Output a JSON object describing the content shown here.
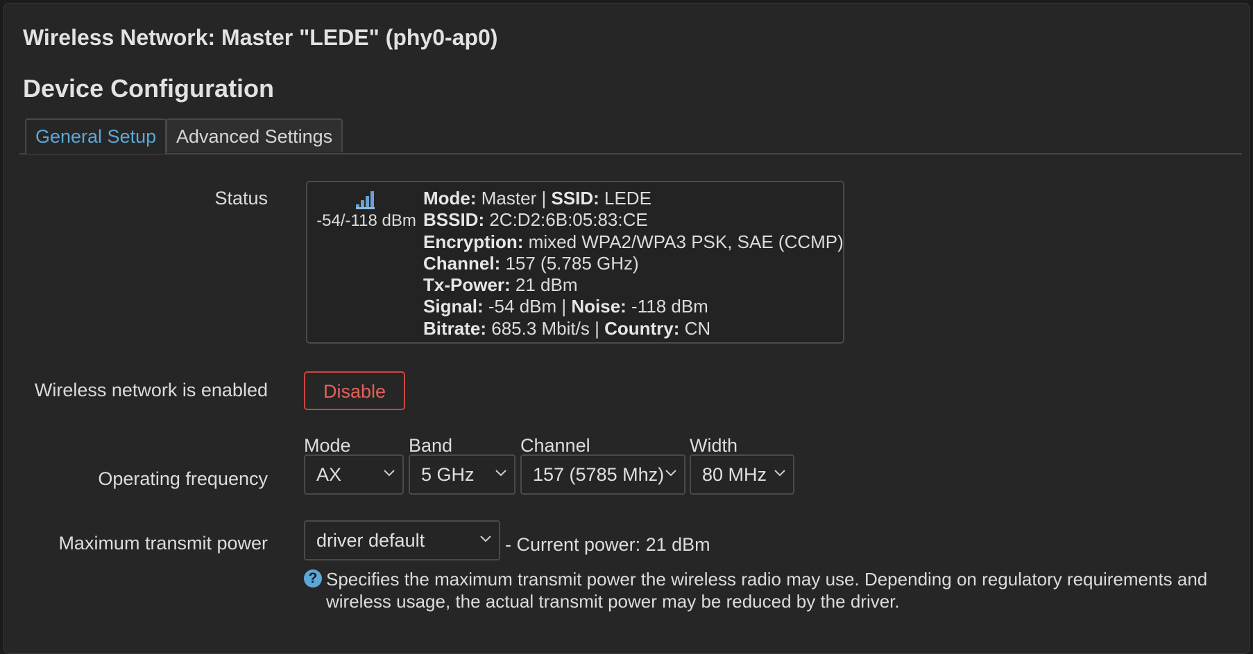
{
  "modal": {
    "title": "Wireless Network: Master \"LEDE\" (phy0-ap0)",
    "section_title": "Device Configuration"
  },
  "tabs": [
    {
      "label": "General Setup",
      "active": true
    },
    {
      "label": "Advanced Settings",
      "active": false
    }
  ],
  "status": {
    "label": "Status",
    "signal_text": "-54/-118 dBm",
    "signal_icon": "signal-bars-icon",
    "lines": [
      {
        "k1": "Mode:",
        "v1": " Master | ",
        "k2": "SSID:",
        "v2": " LEDE"
      },
      {
        "k1": "BSSID:",
        "v1": " 2C:D2:6B:05:83:CE",
        "k2": "",
        "v2": ""
      },
      {
        "k1": "Encryption:",
        "v1": " mixed WPA2/WPA3 PSK, SAE (CCMP)",
        "k2": "",
        "v2": ""
      },
      {
        "k1": "Channel:",
        "v1": " 157 (5.785 GHz)",
        "k2": "",
        "v2": ""
      },
      {
        "k1": "Tx-Power:",
        "v1": " 21 dBm",
        "k2": "",
        "v2": ""
      },
      {
        "k1": "Signal:",
        "v1": " -54 dBm | ",
        "k2": "Noise:",
        "v2": " -118 dBm"
      },
      {
        "k1": "Bitrate:",
        "v1": " 685.3 Mbit/s | ",
        "k2": "Country:",
        "v2": " CN"
      }
    ]
  },
  "enabled": {
    "label": "Wireless network is enabled",
    "button_label": "Disable"
  },
  "frequency": {
    "label": "Operating frequency",
    "mode_label": "Mode",
    "mode_value": "AX",
    "band_label": "Band",
    "band_value": "5 GHz",
    "channel_label": "Channel",
    "channel_value": "157 (5785 Mhz)",
    "width_label": "Width",
    "width_value": "80 MHz"
  },
  "txpower": {
    "label": "Maximum transmit power",
    "value": "driver default",
    "current": "- Current power: 21 dBm",
    "help": "Specifies the maximum transmit power the wireless radio may use. Depending on regulatory requirements and wireless usage, the actual transmit power may be reduced by the driver.",
    "help_icon": "question-circle-icon"
  },
  "colors": {
    "accent": "#5ba7d8",
    "danger": "#c9473f",
    "background": "#262626"
  }
}
